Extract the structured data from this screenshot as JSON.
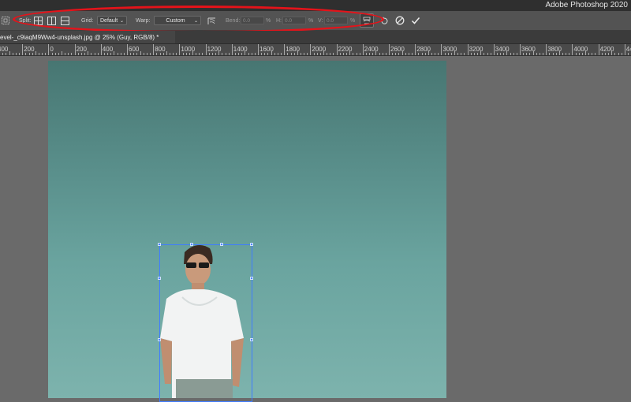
{
  "app": {
    "title": "Adobe Photoshop 2020"
  },
  "options_bar": {
    "split_label": "Split:",
    "grid_label": "Grid:",
    "grid_value": "Default",
    "warp_label": "Warp:",
    "warp_value": "Custom",
    "bend_label": "Bend:",
    "bend_value": "0.0",
    "h_label": "H:",
    "h_value": "0.0",
    "v_label": "V:",
    "v_value": "0.0",
    "percent": "%"
  },
  "document_tab": {
    "label": "evel-_c9iaqM9Ww4-unsplash.jpg @ 25% (Guy, RGB/8) *"
  },
  "ruler": {
    "ticks": [
      "400",
      "200",
      "0",
      "200",
      "400",
      "600",
      "800",
      "1000",
      "1200",
      "1400",
      "1600",
      "1800",
      "2000",
      "2200",
      "2400",
      "2600",
      "2800",
      "3000",
      "3200",
      "3400",
      "3600",
      "3800",
      "4000",
      "4200",
      "4400"
    ]
  },
  "colors": {
    "highlight": "#e5131a",
    "selection": "#3f7cff",
    "sky_top": "#477672",
    "sky_bottom": "#7db3ad"
  }
}
